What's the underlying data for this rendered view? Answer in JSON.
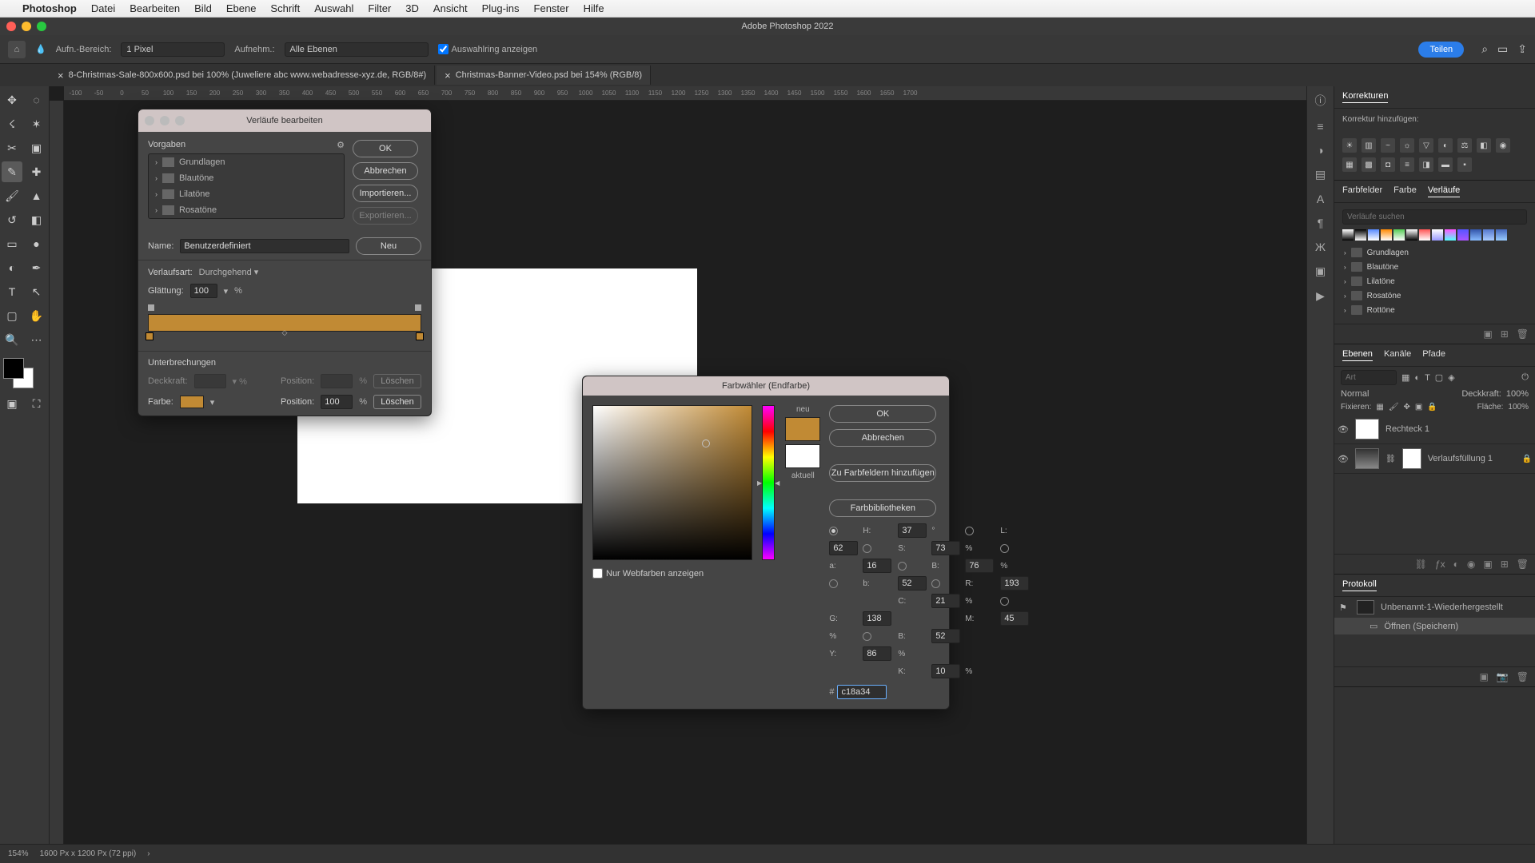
{
  "menubar": {
    "app": "Photoshop",
    "items": [
      "Datei",
      "Bearbeiten",
      "Bild",
      "Ebene",
      "Schrift",
      "Auswahl",
      "Filter",
      "3D",
      "Ansicht",
      "Plug-ins",
      "Fenster",
      "Hilfe"
    ]
  },
  "window_title": "Adobe Photoshop 2022",
  "options": {
    "aufn_bereich_label": "Aufn.-Bereich:",
    "aufn_bereich_value": "1 Pixel",
    "aufnehm_label": "Aufnehm.:",
    "aufnehm_value": "Alle Ebenen",
    "auswahlring": "Auswahlring anzeigen",
    "share": "Teilen"
  },
  "tabs": [
    "8-Christmas-Sale-800x600.psd bei 100% (Juweliere abc www.webadresse-xyz.de, RGB/8#)",
    "Christmas-Banner-Video.psd bei 154% (RGB/8)"
  ],
  "ruler_ticks": [
    "-100",
    "-50",
    "0",
    "50",
    "100",
    "150",
    "200",
    "250",
    "300",
    "350",
    "400",
    "450",
    "500",
    "550",
    "600",
    "650",
    "700",
    "750",
    "800",
    "850",
    "900",
    "950",
    "1000",
    "1050",
    "1100",
    "1150",
    "1200",
    "1250",
    "1300",
    "1350",
    "1400",
    "1450",
    "1500",
    "1550",
    "1600",
    "1650",
    "1700"
  ],
  "gradient_editor": {
    "title": "Verläufe bearbeiten",
    "presets_label": "Vorgaben",
    "preset_folders": [
      "Grundlagen",
      "Blautöne",
      "Lilatöne",
      "Rosatöne"
    ],
    "ok": "OK",
    "cancel": "Abbrechen",
    "import": "Importieren...",
    "export": "Exportieren...",
    "new": "Neu",
    "name_label": "Name:",
    "name_value": "Benutzerdefiniert",
    "type_label": "Verlaufsart:",
    "type_value": "Durchgehend",
    "smooth_label": "Glättung:",
    "smooth_value": "100",
    "pct": "%",
    "stops_label": "Unterbrechungen",
    "opacity_label": "Deckkraft:",
    "pos_label": "Position:",
    "delete": "Löschen",
    "color_label": "Farbe:",
    "pos_value": "100"
  },
  "color_picker": {
    "title": "Farbwähler (Endfarbe)",
    "ok": "OK",
    "cancel": "Abbrechen",
    "add_swatch": "Zu Farbfeldern hinzufügen",
    "libraries": "Farbbibliotheken",
    "new_label": "neu",
    "current_label": "aktuell",
    "web_only": "Nur Webfarben anzeigen",
    "H": "H:",
    "S": "S:",
    "Bv": "B:",
    "R": "R:",
    "G": "G:",
    "Bb": "B:",
    "L": "L:",
    "a": "a:",
    "b": "b:",
    "C": "C:",
    "M": "M:",
    "Y": "Y:",
    "K": "K:",
    "h_val": "37",
    "s_val": "73",
    "bv_val": "76",
    "r_val": "193",
    "g_val": "138",
    "bb_val": "52",
    "l_val": "62",
    "a_val": "16",
    "lb_val": "52",
    "c_val": "21",
    "m_val": "45",
    "y_val": "86",
    "k_val": "10",
    "hex_label": "#",
    "hex_val": "c18a34",
    "deg": "°",
    "pct": "%"
  },
  "panels": {
    "korrekturen": "Korrekturen",
    "korrektur_add": "Korrektur hinzufügen:",
    "farbfelder": "Farbfelder",
    "farbe": "Farbe",
    "verlaufe": "Verläufe",
    "search_placeholder": "Verläufe suchen",
    "grad_folders": [
      "Grundlagen",
      "Blautöne",
      "Lilatöne",
      "Rosatöne",
      "Rottöne"
    ],
    "ebenen": "Ebenen",
    "kanale": "Kanäle",
    "pfade": "Pfade",
    "art_placeholder": "Art",
    "blend": "Normal",
    "deckkraft_label": "Deckkraft:",
    "deckkraft_val": "100%",
    "fixieren": "Fixieren:",
    "flache_label": "Fläche:",
    "flache_val": "100%",
    "layer1": "Rechteck 1",
    "layer2": "Verlaufsfüllung 1",
    "protokoll": "Protokoll",
    "hist1": "Unbenannt-1-Wiederhergestellt",
    "hist2": "Öffnen (Speichern)"
  },
  "status": {
    "zoom": "154%",
    "dims": "1600 Px x 1200 Px (72 ppi)"
  }
}
